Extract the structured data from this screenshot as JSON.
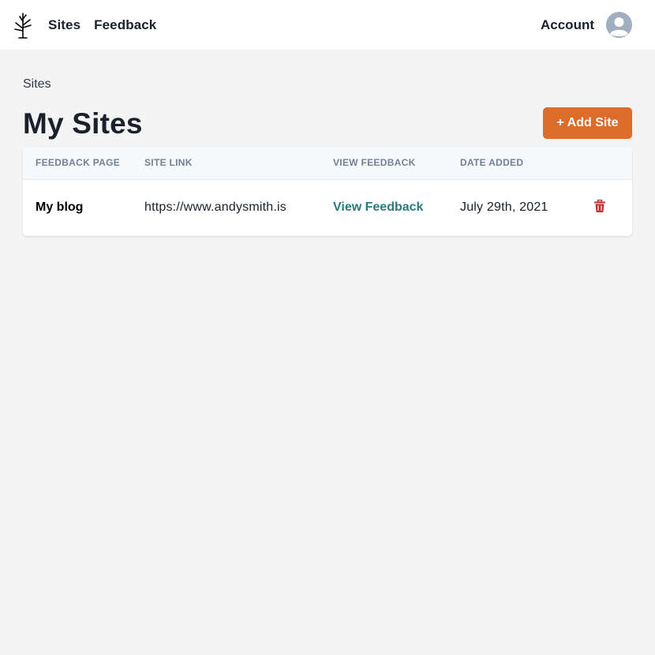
{
  "nav": {
    "logo_icon": "tree-icon",
    "links": [
      {
        "label": "Sites"
      },
      {
        "label": "Feedback"
      }
    ],
    "account_label": "Account",
    "avatar_icon": "user-avatar-icon"
  },
  "breadcrumb": "Sites",
  "page_title": "My Sites",
  "add_button_label": "+ Add Site",
  "colors": {
    "accent": "#dd6b2a",
    "link": "#2c7a7b",
    "danger": "#c53030",
    "background": "#f4f4f4"
  },
  "table": {
    "headers": [
      "Feedback Page",
      "Site Link",
      "View Feedback",
      "Date Added"
    ],
    "rows": [
      {
        "name": "My blog",
        "url": "https://www.andysmith.is",
        "view_label": "View Feedback",
        "date": "July 29th, 2021",
        "delete_icon": "trash-icon"
      }
    ]
  }
}
